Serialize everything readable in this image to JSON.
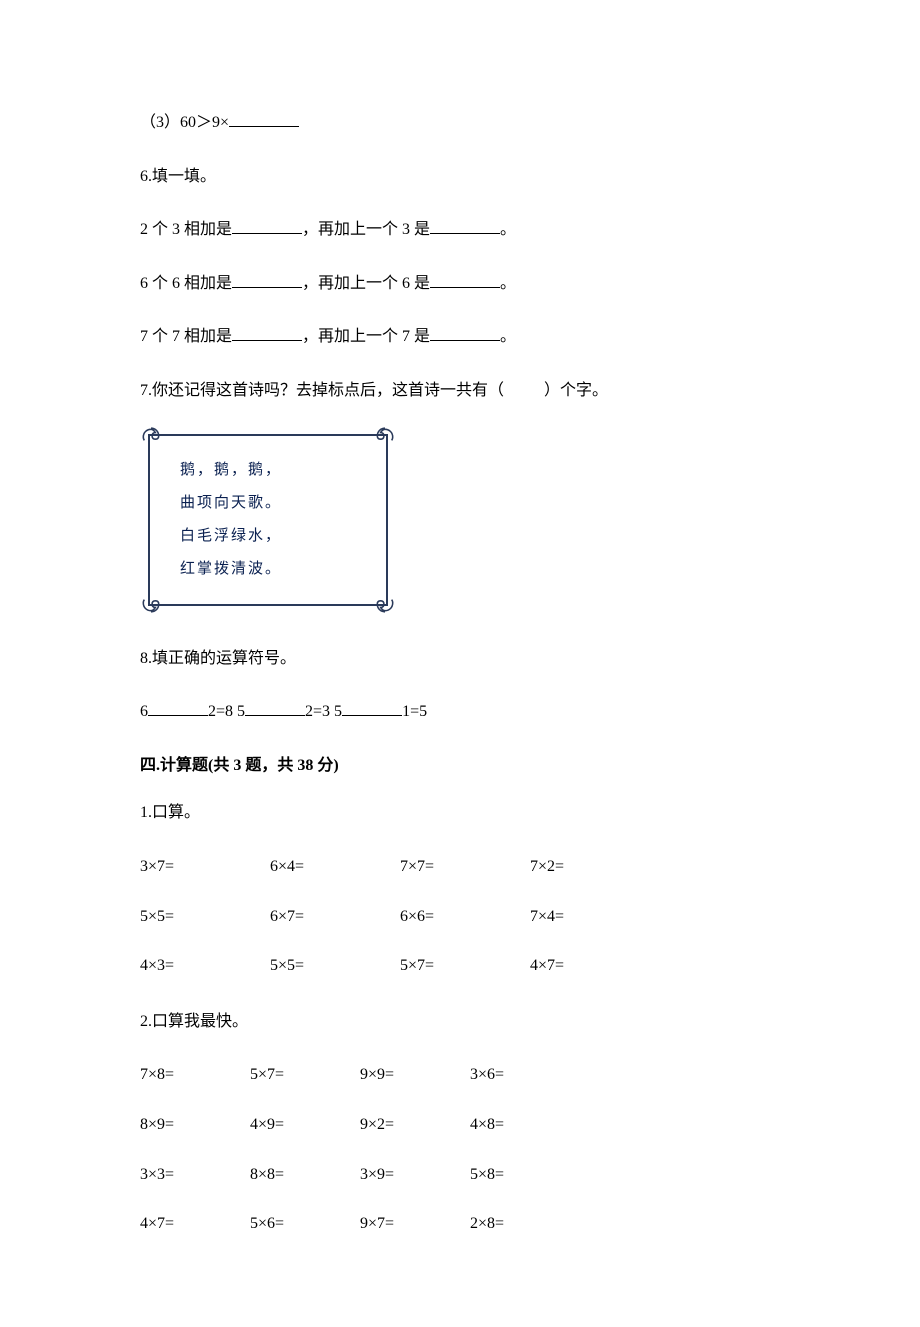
{
  "q5_3": "（3）60＞9×",
  "q6": {
    "title": "6.填一填。",
    "rows": [
      {
        "a": "2 个 3 相加是",
        "b": "，再加上一个 3 是",
        "c": "。"
      },
      {
        "a": "6 个 6 相加是",
        "b": "，再加上一个 6 是",
        "c": "。"
      },
      {
        "a": "7 个 7 相加是",
        "b": "，再加上一个 7 是",
        "c": "。"
      }
    ]
  },
  "q7": {
    "text_a": "7.你还记得这首诗吗？去掉标点后，这首诗一共有（",
    "text_b": "）个字。",
    "poem": [
      "鹅，鹅，鹅，",
      "曲项向天歌。",
      "白毛浮绿水，",
      "红掌拨清波。"
    ]
  },
  "q8": {
    "title": "8.填正确的运算符号。",
    "parts": [
      "6",
      "2=8  5",
      "2=3  5",
      "1=5"
    ]
  },
  "section4": {
    "head": "四.计算题(共 3 题，共 38 分)",
    "q1": {
      "title": "1.口算。",
      "cells": [
        "3×7=",
        "6×4=",
        "7×7=",
        "7×2=",
        "5×5=",
        "6×7=",
        "6×6=",
        "7×4=",
        "4×3=",
        "5×5=",
        "5×7=",
        "4×7="
      ]
    },
    "q2": {
      "title": "2.口算我最快。",
      "cells": [
        "7×8=",
        "5×7=",
        "9×9=",
        "3×6=",
        "8×9=",
        "4×9=",
        "9×2=",
        "4×8=",
        "3×3=",
        "8×8=",
        "3×9=",
        "5×8=",
        "4×7=",
        "5×6=",
        "9×7=",
        "2×8="
      ]
    }
  }
}
